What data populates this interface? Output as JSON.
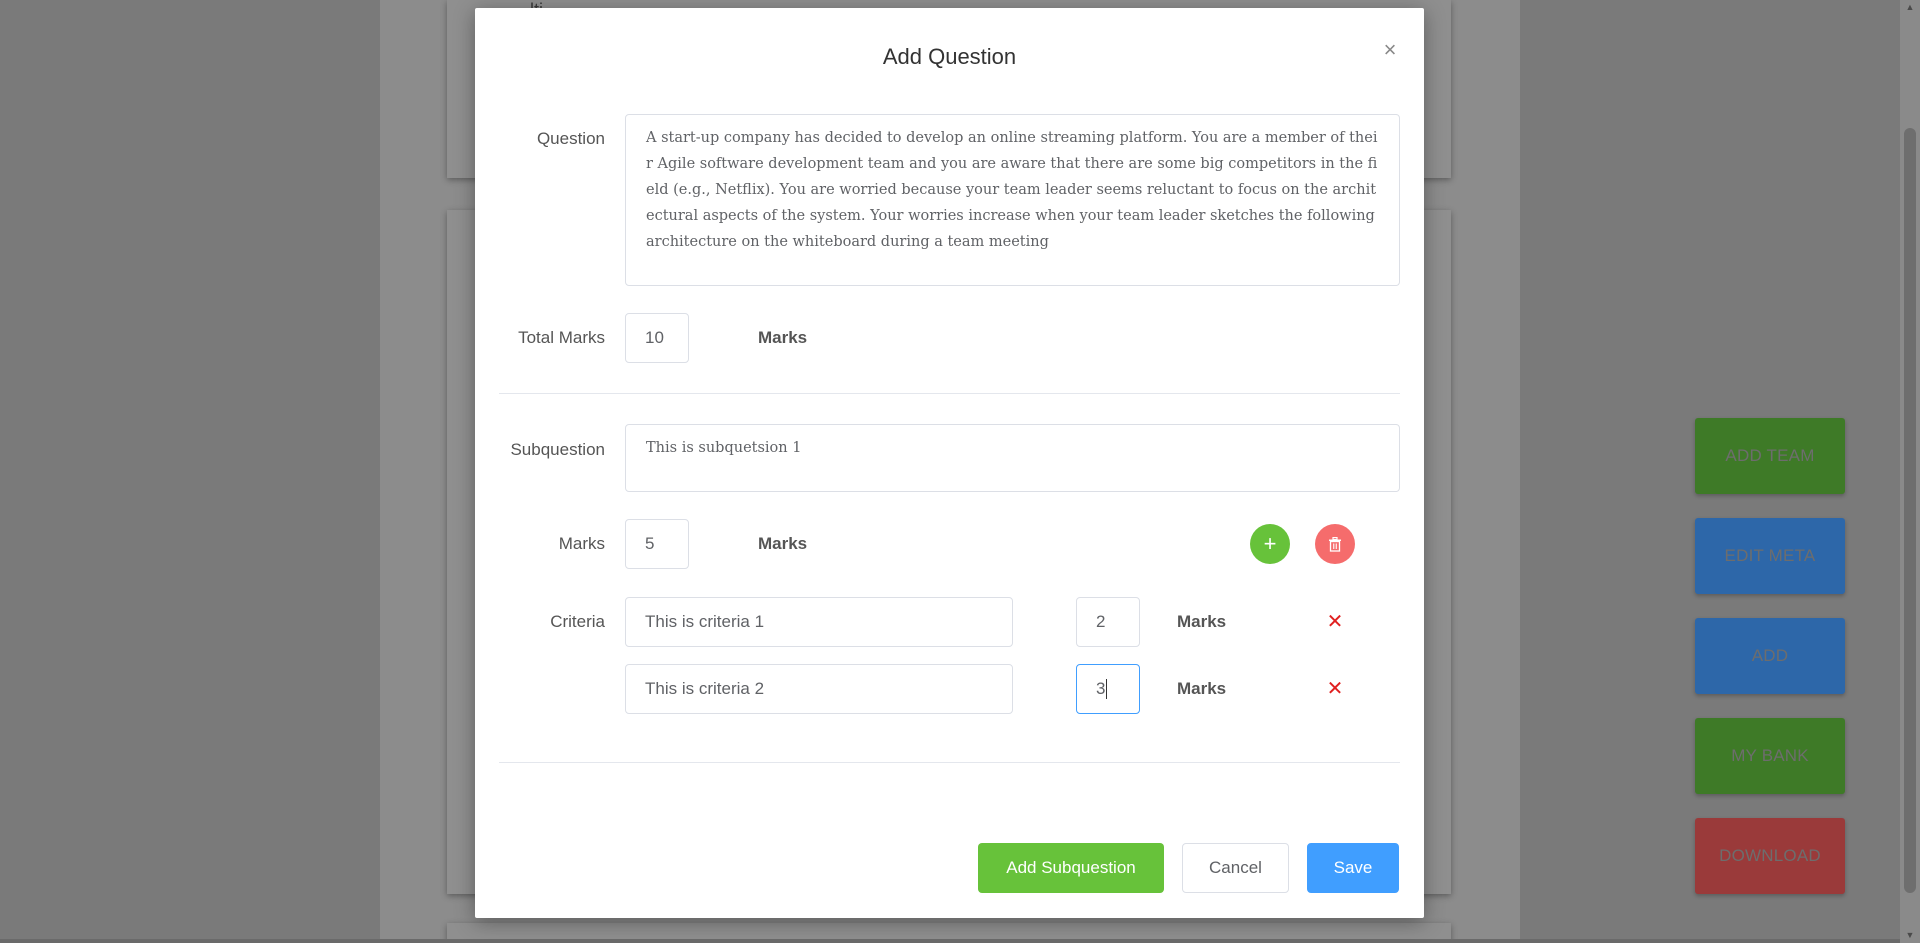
{
  "background": {
    "peek_text": "lti"
  },
  "side_buttons": [
    {
      "label": "ADD TEAM",
      "color": "#3e7a27"
    },
    {
      "label": "EDIT META",
      "color": "#2d67a9"
    },
    {
      "label": "ADD",
      "color": "#2d67a9"
    },
    {
      "label": "MY BANK",
      "color": "#3e7a27"
    },
    {
      "label": "DOWNLOAD",
      "color": "#9a3a3a"
    }
  ],
  "modal": {
    "title": "Add Question",
    "close_icon": "close-icon",
    "question_label": "Question",
    "question_text": "A start-up company has decided to develop an online streaming platform. You are a member of their Agile software development team and you are aware that there are some big competitors in the field (e.g., Netflix). You are worried because your team leader seems reluctant to focus on the architectural aspects of the system. Your worries increase when your team leader sketches the following architecture on the whiteboard during a team meeting",
    "total_marks_label": "Total Marks",
    "total_marks_value": "10",
    "marks_suffix": "Marks",
    "subquestion_label": "Subquestion",
    "subquestion_text": "This is subquetsion 1",
    "marks_label": "Marks",
    "marks_value": "5",
    "criteria_label": "Criteria",
    "criteria": [
      {
        "text": "This is criteria 1",
        "marks": "2"
      },
      {
        "text": "This is criteria 2",
        "marks": "3"
      }
    ],
    "buttons": {
      "add_subquestion": "Add Subquestion",
      "cancel": "Cancel",
      "save": "Save"
    }
  },
  "colors": {
    "success": "#67c23a",
    "danger": "#f56c6c",
    "primary": "#409eff"
  }
}
